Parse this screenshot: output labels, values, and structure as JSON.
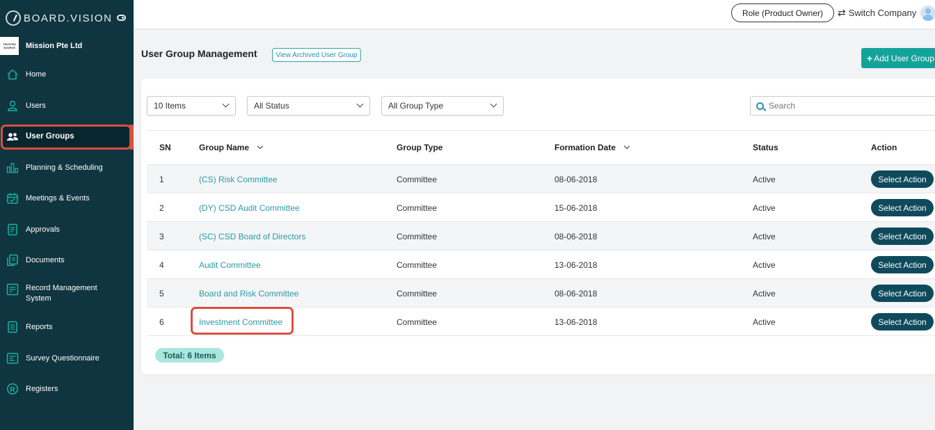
{
  "brand": {
    "name": "BOARD.VISION"
  },
  "company": {
    "logo_text_1": "TRUSTED",
    "logo_text_2": "SOURCE",
    "name": "Mission Pte Ltd"
  },
  "sidebar": {
    "items": [
      {
        "label": "Home",
        "icon": "home-icon"
      },
      {
        "label": "Users",
        "icon": "user-icon"
      },
      {
        "label": "User Groups",
        "icon": "user-group-icon",
        "active": true
      },
      {
        "label": "Planning & Scheduling",
        "icon": "bar-chart-icon"
      },
      {
        "label": "Meetings & Events",
        "icon": "calendar-icon"
      },
      {
        "label": "Approvals",
        "icon": "document-icon"
      },
      {
        "label": "Documents",
        "icon": "documents-icon"
      },
      {
        "label": "Record Management System",
        "label_line1": "Record Management",
        "label_line2": "System",
        "icon": "record-icon"
      },
      {
        "label": "Reports",
        "icon": "report-icon"
      },
      {
        "label": "Survey Questionnaire",
        "icon": "survey-icon"
      },
      {
        "label": "Registers",
        "icon": "registers-icon"
      }
    ]
  },
  "topbar": {
    "role_label": "Role (Product Owner)",
    "switch_label": "Switch Company"
  },
  "page": {
    "title": "User Group Management",
    "archived_label": "View Archived User Group",
    "add_label": "Add User Group"
  },
  "filters": {
    "items_per_page": "10 Items",
    "status": "All Status",
    "group_type": "All Group Type",
    "search_placeholder": "Search"
  },
  "table": {
    "headers": {
      "sn": "SN",
      "group_name": "Group Name",
      "group_type": "Group Type",
      "formation_date": "Formation Date",
      "status": "Status",
      "action": "Action"
    },
    "rows": [
      {
        "sn": "1",
        "group_name": "(CS) Risk Committee",
        "group_type": "Committee",
        "formation_date": "08-06-2018",
        "status": "Active",
        "action": "Select Action"
      },
      {
        "sn": "2",
        "group_name": "(DY) CSD Audit Committee",
        "group_type": "Committee",
        "formation_date": "15-06-2018",
        "status": "Active",
        "action": "Select Action"
      },
      {
        "sn": "3",
        "group_name": "(SC) CSD Board of Directors",
        "group_type": "Committee",
        "formation_date": "08-06-2018",
        "status": "Active",
        "action": "Select Action"
      },
      {
        "sn": "4",
        "group_name": "Audit Committee",
        "group_type": "Committee",
        "formation_date": "13-06-2018",
        "status": "Active",
        "action": "Select Action"
      },
      {
        "sn": "5",
        "group_name": "Board and Risk Committee",
        "group_type": "Committee",
        "formation_date": "08-06-2018",
        "status": "Active",
        "action": "Select Action"
      },
      {
        "sn": "6",
        "group_name": "Investment Committee",
        "group_type": "Committee",
        "formation_date": "13-06-2018",
        "status": "Active",
        "action": "Select Action"
      }
    ],
    "total": "Total: 6 Items"
  },
  "colors": {
    "sidebar_bg": "#0f3540",
    "accent_teal": "#14a39b",
    "link": "#2a9aa4",
    "action_btn": "#0e4a5c",
    "highlight": "#d9503f"
  }
}
